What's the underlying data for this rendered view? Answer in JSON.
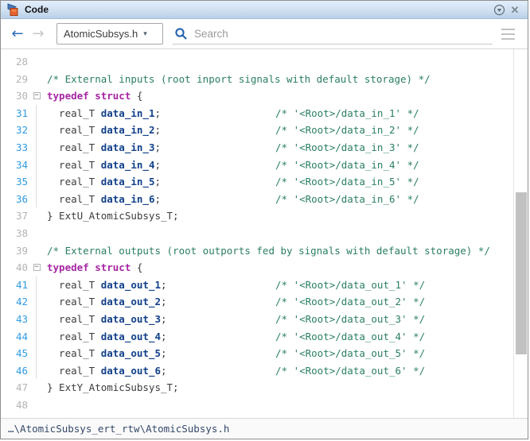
{
  "titlebar": {
    "title": "Code",
    "app_icon": "simulink-code-icon",
    "minimize_menu_icon": "circle-chevron-down-icon",
    "close_icon": "close-icon"
  },
  "toolbar": {
    "back_arrow": "←",
    "forward_arrow": "→",
    "file_selector": {
      "value": "AtomicSubsys.h",
      "caret": "▾"
    },
    "search": {
      "placeholder": "Search"
    }
  },
  "colors": {
    "titlebar_gradient_top": "#e3eefa",
    "titlebar_gradient_bottom": "#b9d0e8",
    "line_number_link": "#2e9be2",
    "line_number_plain": "#b4b4b4",
    "comment_green": "#2a7f62",
    "keyword_purple": "#a626a4",
    "identifier_navy": "#12418a",
    "code_plain": "#3c3c3c",
    "scrollbar_thumb": "#c1c1c1"
  },
  "code": {
    "fold_glyph": "−",
    "lines": [
      {
        "n": "28",
        "blue": false,
        "fold": false,
        "guide": false,
        "seg": [],
        "trail": null
      },
      {
        "n": "29",
        "blue": false,
        "fold": false,
        "guide": false,
        "seg": [
          [
            "/* External inputs (root inport signals with default storage) */",
            "c"
          ]
        ],
        "trail": null
      },
      {
        "n": "30",
        "blue": false,
        "fold": true,
        "guide": false,
        "seg": [
          [
            "typedef struct",
            "k"
          ],
          [
            " {",
            "p"
          ]
        ],
        "trail": null
      },
      {
        "n": "31",
        "blue": true,
        "fold": false,
        "guide": true,
        "seg": [
          [
            "  real_T ",
            "p"
          ],
          [
            "data_in_1",
            "i"
          ],
          [
            ";",
            "p"
          ]
        ],
        "trail": "/* '<Root>/data_in_1' */"
      },
      {
        "n": "32",
        "blue": true,
        "fold": false,
        "guide": true,
        "seg": [
          [
            "  real_T ",
            "p"
          ],
          [
            "data_in_2",
            "i"
          ],
          [
            ";",
            "p"
          ]
        ],
        "trail": "/* '<Root>/data_in_2' */"
      },
      {
        "n": "33",
        "blue": true,
        "fold": false,
        "guide": true,
        "seg": [
          [
            "  real_T ",
            "p"
          ],
          [
            "data_in_3",
            "i"
          ],
          [
            ";",
            "p"
          ]
        ],
        "trail": "/* '<Root>/data_in_3' */"
      },
      {
        "n": "34",
        "blue": true,
        "fold": false,
        "guide": true,
        "seg": [
          [
            "  real_T ",
            "p"
          ],
          [
            "data_in_4",
            "i"
          ],
          [
            ";",
            "p"
          ]
        ],
        "trail": "/* '<Root>/data_in_4' */"
      },
      {
        "n": "35",
        "blue": true,
        "fold": false,
        "guide": true,
        "seg": [
          [
            "  real_T ",
            "p"
          ],
          [
            "data_in_5",
            "i"
          ],
          [
            ";",
            "p"
          ]
        ],
        "trail": "/* '<Root>/data_in_5' */"
      },
      {
        "n": "36",
        "blue": true,
        "fold": false,
        "guide": true,
        "seg": [
          [
            "  real_T ",
            "p"
          ],
          [
            "data_in_6",
            "i"
          ],
          [
            ";",
            "p"
          ]
        ],
        "trail": "/* '<Root>/data_in_6' */"
      },
      {
        "n": "37",
        "blue": false,
        "fold": false,
        "guide": false,
        "seg": [
          [
            "} ExtU_AtomicSubsys_T;",
            "p"
          ]
        ],
        "trail": null
      },
      {
        "n": "38",
        "blue": false,
        "fold": false,
        "guide": false,
        "seg": [],
        "trail": null
      },
      {
        "n": "39",
        "blue": false,
        "fold": false,
        "guide": false,
        "seg": [
          [
            "/* External outputs (root outports fed by signals with default storage) */",
            "c"
          ]
        ],
        "trail": null
      },
      {
        "n": "40",
        "blue": false,
        "fold": true,
        "guide": false,
        "seg": [
          [
            "typedef struct",
            "k"
          ],
          [
            " {",
            "p"
          ]
        ],
        "trail": null
      },
      {
        "n": "41",
        "blue": true,
        "fold": false,
        "guide": true,
        "seg": [
          [
            "  real_T ",
            "p"
          ],
          [
            "data_out_1",
            "i"
          ],
          [
            ";",
            "p"
          ]
        ],
        "trail": "/* '<Root>/data_out_1' */"
      },
      {
        "n": "42",
        "blue": true,
        "fold": false,
        "guide": true,
        "seg": [
          [
            "  real_T ",
            "p"
          ],
          [
            "data_out_2",
            "i"
          ],
          [
            ";",
            "p"
          ]
        ],
        "trail": "/* '<Root>/data_out_2' */"
      },
      {
        "n": "43",
        "blue": true,
        "fold": false,
        "guide": true,
        "seg": [
          [
            "  real_T ",
            "p"
          ],
          [
            "data_out_3",
            "i"
          ],
          [
            ";",
            "p"
          ]
        ],
        "trail": "/* '<Root>/data_out_3' */"
      },
      {
        "n": "44",
        "blue": true,
        "fold": false,
        "guide": true,
        "seg": [
          [
            "  real_T ",
            "p"
          ],
          [
            "data_out_4",
            "i"
          ],
          [
            ";",
            "p"
          ]
        ],
        "trail": "/* '<Root>/data_out_4' */"
      },
      {
        "n": "45",
        "blue": true,
        "fold": false,
        "guide": true,
        "seg": [
          [
            "  real_T ",
            "p"
          ],
          [
            "data_out_5",
            "i"
          ],
          [
            ";",
            "p"
          ]
        ],
        "trail": "/* '<Root>/data_out_5' */"
      },
      {
        "n": "46",
        "blue": true,
        "fold": false,
        "guide": true,
        "seg": [
          [
            "  real_T ",
            "p"
          ],
          [
            "data_out_6",
            "i"
          ],
          [
            ";",
            "p"
          ]
        ],
        "trail": "/* '<Root>/data_out_6' */"
      },
      {
        "n": "47",
        "blue": false,
        "fold": false,
        "guide": false,
        "seg": [
          [
            "} ExtY_AtomicSubsys_T;",
            "p"
          ]
        ],
        "trail": null
      },
      {
        "n": "48",
        "blue": false,
        "fold": false,
        "guide": false,
        "seg": [],
        "trail": null
      }
    ]
  },
  "statusbar": {
    "path": "…\\AtomicSubsys_ert_rtw\\AtomicSubsys.h"
  }
}
